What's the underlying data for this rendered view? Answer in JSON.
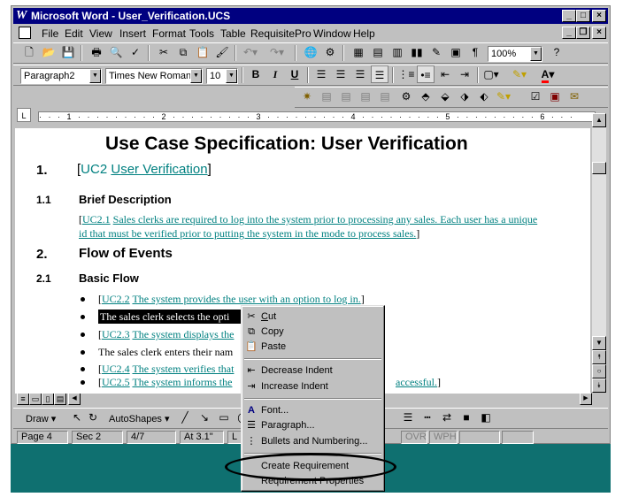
{
  "window": {
    "title": "Microsoft Word - User_Verification.UCS",
    "app_icon": "word-w-icon"
  },
  "menu": [
    "File",
    "Edit",
    "View",
    "Insert",
    "Format",
    "Tools",
    "Table",
    "RequisitePro",
    "Window",
    "Help"
  ],
  "toolbar": {
    "zoom": "100%",
    "style": "Paragraph2",
    "font": "Times New Roman",
    "size": "10"
  },
  "ruler": {
    "text": "· · · 1 · · · · · · · · · 2 · · · · · · · · · 3 · · · · · · · · · 4 · · · · · · · · · 5 · · · · · · · · · 6 · · ·"
  },
  "document": {
    "title": "Use Case Specification: User Verification",
    "sec1": {
      "num": "1.",
      "id": "UC2",
      "name": "User Verification"
    },
    "sec1_1": {
      "num": "1.1",
      "title": "Brief Description"
    },
    "brief": {
      "id": "UC2.1",
      "text1": "Sales clerks are required to log into the system prior to processing any sales.  Each user has a unique",
      "text2": "id that must be verified prior to putting the system in the mode to process sales."
    },
    "sec2": {
      "num": "2.",
      "title": "Flow of Events"
    },
    "sec2_1": {
      "num": "2.1",
      "title": "Basic Flow"
    },
    "bullets": [
      {
        "id": "UC2.2",
        "text": "The system provides the user with an option to log in."
      },
      {
        "id": "",
        "text": "The sales clerk selects the opti"
      },
      {
        "id": "UC2.3",
        "text": "The system displays the"
      },
      {
        "id": "",
        "text": "The sales clerk enters their nam"
      },
      {
        "id": "UC2.4",
        "text": "The system verifies that"
      },
      {
        "id": "UC2.5",
        "text": "The system informs the",
        "tail": "accessful."
      }
    ]
  },
  "context_menu": {
    "items": [
      {
        "label": "Cut",
        "icon": "scissors-icon"
      },
      {
        "label": "Copy",
        "icon": "copy-icon"
      },
      {
        "label": "Paste",
        "icon": "paste-icon"
      },
      {
        "label": "Decrease Indent",
        "icon": "decrease-indent-icon"
      },
      {
        "label": "Increase Indent",
        "icon": "increase-indent-icon"
      },
      {
        "label": "Font...",
        "icon": "font-a-icon"
      },
      {
        "label": "Paragraph...",
        "icon": "paragraph-icon"
      },
      {
        "label": "Bullets and Numbering...",
        "icon": "bullets-icon"
      },
      {
        "label": "Create Requirement",
        "icon": ""
      },
      {
        "label": "Requirement Properties",
        "icon": ""
      }
    ]
  },
  "drawbar": {
    "draw": "Draw",
    "autoshapes": "AutoShapes"
  },
  "status": {
    "page": "Page 4",
    "sec": "Sec 2",
    "pages": "4/7",
    "at": "At 3.1\"",
    "ln": "L",
    "ovr": "OVR",
    "wph": "WPH"
  },
  "colors": {
    "title_bar": "#000080",
    "requirement_link": "#008080",
    "desktop": "#0f7070",
    "chrome": "#c0c0c0"
  }
}
